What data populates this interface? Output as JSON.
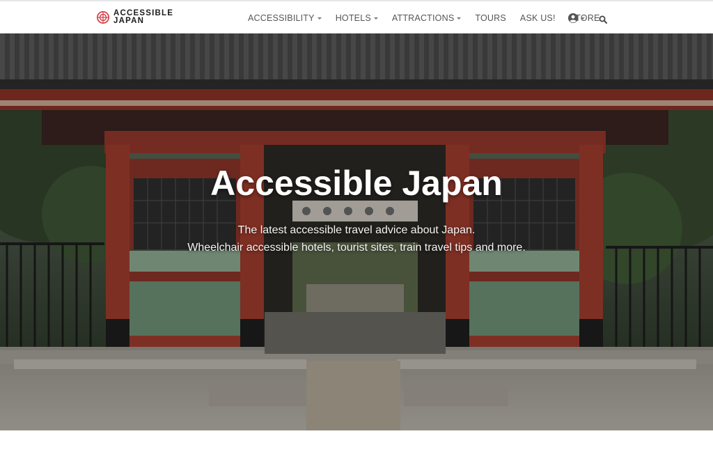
{
  "brand": {
    "line1": "ACCESSIBLE",
    "line2": "JAPAN",
    "accent_color": "#d9424a",
    "icon": "logo-mark"
  },
  "nav": {
    "items": [
      {
        "label": "ACCESSIBILITY",
        "dropdown": true
      },
      {
        "label": "HOTELS",
        "dropdown": true
      },
      {
        "label": "ATTRACTIONS",
        "dropdown": true
      },
      {
        "label": "TOURS",
        "dropdown": false
      },
      {
        "label": "ASK US!",
        "dropdown": false
      },
      {
        "label": "STORE",
        "dropdown": false
      }
    ],
    "user_icon": "user-circle-icon",
    "search_icon": "search-icon"
  },
  "hero": {
    "title": "Accessible Japan",
    "subtitle_line1": "The latest accessible travel advice about Japan.",
    "subtitle_line2": "Wheelchair accessible hotels, tourist sites, train travel tips and more."
  },
  "colors": {
    "gate_red": "#9b3a2c",
    "gate_green": "#6f8f78",
    "roof": "#3c3c3c",
    "nav_text": "#555555"
  }
}
